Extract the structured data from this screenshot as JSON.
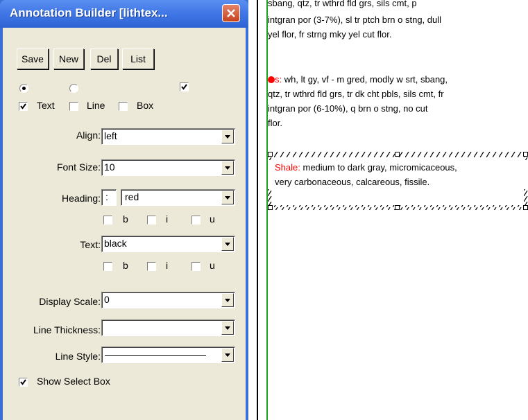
{
  "window": {
    "title": "Annotation Builder [lithtex...",
    "close_icon": "close-x-icon"
  },
  "toolbar": {
    "save_label": "Save",
    "new_label": "New",
    "del_label": "Del",
    "list_label": "List"
  },
  "options": {
    "radio1_selected": true,
    "radio2_selected": false,
    "top_check_checked": true,
    "text_label": "Text",
    "text_checked": true,
    "line_label": "Line",
    "line_checked": false,
    "box_label": "Box",
    "box_checked": false
  },
  "form": {
    "align_label": "Align:",
    "align_value": "left",
    "font_size_label": "Font Size:",
    "font_size_value": "10",
    "heading_label": "Heading:",
    "heading_sep": ":",
    "heading_color": "red",
    "heading_b": "b",
    "heading_i": "i",
    "heading_u": "u",
    "text_label": "Text:",
    "text_color": "black",
    "text_b": "b",
    "text_i": "i",
    "text_u": "u",
    "display_scale_label": "Display Scale:",
    "display_scale_value": "0",
    "line_thickness_label": "Line Thickness:",
    "line_thickness_value": "",
    "line_style_label": "Line Style:",
    "show_select_box_label": "Show Select Box",
    "show_select_box_checked": true
  },
  "document": {
    "para1_lines": [
      "sbang, qtz, tr wthrd fld grs, sils cmt, p",
      "intgran por (3-7%), sl tr ptch brn o stng, dull",
      "yel flor, fr strng mky yel cut flor."
    ],
    "para2_prefix": "s:",
    "para2_first": " wh, lt gy, vf - m gred, modly w srt, sbang,",
    "para2_lines": [
      "qtz, tr wthrd fld grs, tr dk cht pbls, sils cmt, fr",
      "intgran por (6-10%), q brn o stng, no cut",
      "flor."
    ],
    "shale_heading": "Shale:",
    "shale_line1": " medium to dark gray, micromicaceous,",
    "shale_line2": "very carbonaceous, calcareous, fissile.",
    "heading_color_hex": "#ff0000",
    "green_line_color": "#1aa41a"
  }
}
